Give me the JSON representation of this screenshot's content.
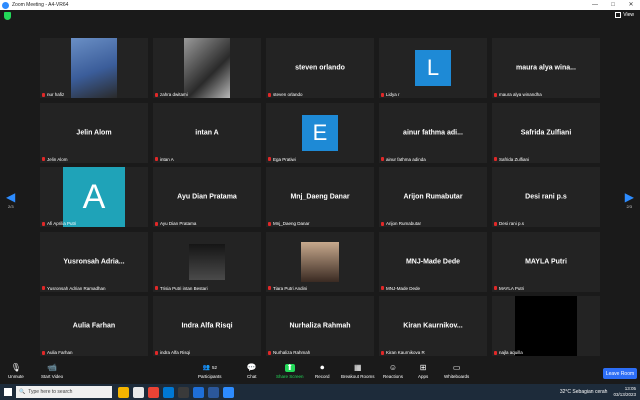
{
  "window": {
    "title": "Zoom Meeting - A4-VR64",
    "controls": [
      "—",
      "□",
      "✕"
    ]
  },
  "topbar": {
    "view_label": "View"
  },
  "pagination": {
    "left": "2/3",
    "right": "2/3",
    "left_arrow": "◀",
    "right_arrow": "▶"
  },
  "participants": [
    {
      "display": "",
      "name": "nur hafiz",
      "kind": "video"
    },
    {
      "display": "",
      "name": "zahra dwitami",
      "kind": "video"
    },
    {
      "display": "steven orlando",
      "name": "steven orlando",
      "kind": "name"
    },
    {
      "display": "L",
      "name": "Lidya r",
      "kind": "letter"
    },
    {
      "display": "maura alya wina...",
      "name": "maura alya winandha",
      "kind": "name"
    },
    {
      "display": "Jelin Alom",
      "name": "Jelin Alom",
      "kind": "name"
    },
    {
      "display": "intan A",
      "name": "intan A",
      "kind": "name"
    },
    {
      "display": "E",
      "name": "Ega Pratiwi",
      "kind": "letter"
    },
    {
      "display": "ainur fathma adi...",
      "name": "ainur fathma adinda",
      "kind": "name"
    },
    {
      "display": "Safrida Zulfiani",
      "name": "Safrida Zulfiani",
      "kind": "name"
    },
    {
      "display": "A",
      "name": "Afi Aprilia Putri",
      "kind": "letter-big"
    },
    {
      "display": "Ayu Dian Pratama",
      "name": "Ayu Dian Pratama",
      "kind": "name"
    },
    {
      "display": "Mnj_Daeng Danar",
      "name": "Mnj_Daeng Danar",
      "kind": "name"
    },
    {
      "display": "Arijon Rumabutar",
      "name": "Arijon Rumabutar",
      "kind": "name"
    },
    {
      "display": "Desi rani p.s",
      "name": "Desi rani p.s",
      "kind": "name"
    },
    {
      "display": "Yusronsah Adria...",
      "name": "Yusronsah Adrian Ramadhan",
      "kind": "name"
    },
    {
      "display": "",
      "name": "Trisia Putri intan Bestari",
      "kind": "video"
    },
    {
      "display": "",
      "name": "Tiara Putri Andini",
      "kind": "video"
    },
    {
      "display": "MNJ-Made Dede",
      "name": "MNJ-Made Dede",
      "kind": "name"
    },
    {
      "display": "MAYLA Putri",
      "name": "MAYLA Putri",
      "kind": "name"
    },
    {
      "display": "Aulia Farhan",
      "name": "Aulia Farhan",
      "kind": "name"
    },
    {
      "display": "Indra Alfa Risqi",
      "name": "indra Alfa Risqi",
      "kind": "name"
    },
    {
      "display": "Nurhaliza Rahmah",
      "name": "Nurhaliza Rahmah",
      "kind": "name"
    },
    {
      "display": "Kiran Kaurnikov...",
      "name": "Kiran Kaurnikova R",
      "kind": "name"
    },
    {
      "display": "",
      "name": "najla aquilla",
      "kind": "video-black"
    }
  ],
  "toolbar": {
    "unmute": "Unmute",
    "start_video": "Start Video",
    "participants": "Participants",
    "participants_count": "52",
    "chat": "Chat",
    "share": "Share Screen",
    "record": "Record",
    "breakout": "Breakout Rooms",
    "reactions": "Reactions",
    "apps": "Apps",
    "whiteboards": "Whiteboards",
    "leave": "Leave Room"
  },
  "taskbar": {
    "search_placeholder": "Type here to search",
    "weather": "32°C  Sebagian cerah",
    "time": "13:05",
    "date": "03/13/2023"
  },
  "colors": {
    "accent": "#2d8cff",
    "letter_tile": "#1e8ad6",
    "big_a_tile": "#1fa3b8",
    "share_green": "#23d959",
    "leave_blue": "#2d6ef6"
  }
}
